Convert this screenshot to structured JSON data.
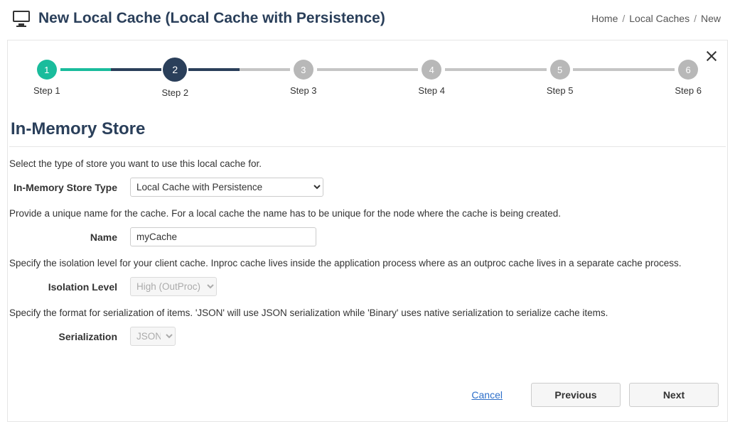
{
  "header": {
    "title": "New Local Cache (Local Cache with Persistence)",
    "breadcrumb": {
      "home": "Home",
      "local_caches": "Local Caches",
      "current": "New"
    }
  },
  "stepper": {
    "steps": [
      {
        "num": "1",
        "label": "Step 1",
        "state": "done"
      },
      {
        "num": "2",
        "label": "Step 2",
        "state": "current"
      },
      {
        "num": "3",
        "label": "Step 3",
        "state": "pending"
      },
      {
        "num": "4",
        "label": "Step 4",
        "state": "pending"
      },
      {
        "num": "5",
        "label": "Step 5",
        "state": "pending"
      },
      {
        "num": "6",
        "label": "Step 6",
        "state": "pending"
      }
    ]
  },
  "section": {
    "title": "In-Memory Store"
  },
  "form": {
    "store_type": {
      "help": "Select the type of store you want to use this local cache for.",
      "label": "In-Memory Store Type",
      "value": "Local Cache with Persistence"
    },
    "name": {
      "help": "Provide a unique name for the cache. For a local cache the name has to be unique for the node where the cache is being created.",
      "label": "Name",
      "value": "myCache"
    },
    "isolation": {
      "help": "Specify the isolation level for your client cache. Inproc cache lives inside the application process where as an outproc cache lives in a separate cache process.",
      "label": "Isolation Level",
      "value": "High (OutProc)"
    },
    "serialization": {
      "help": "Specify the format for serialization of items. 'JSON' will use JSON serialization while 'Binary' uses native serialization to serialize cache items.",
      "label": "Serialization",
      "value": "JSON"
    }
  },
  "footer": {
    "cancel": "Cancel",
    "previous": "Previous",
    "next": "Next"
  }
}
